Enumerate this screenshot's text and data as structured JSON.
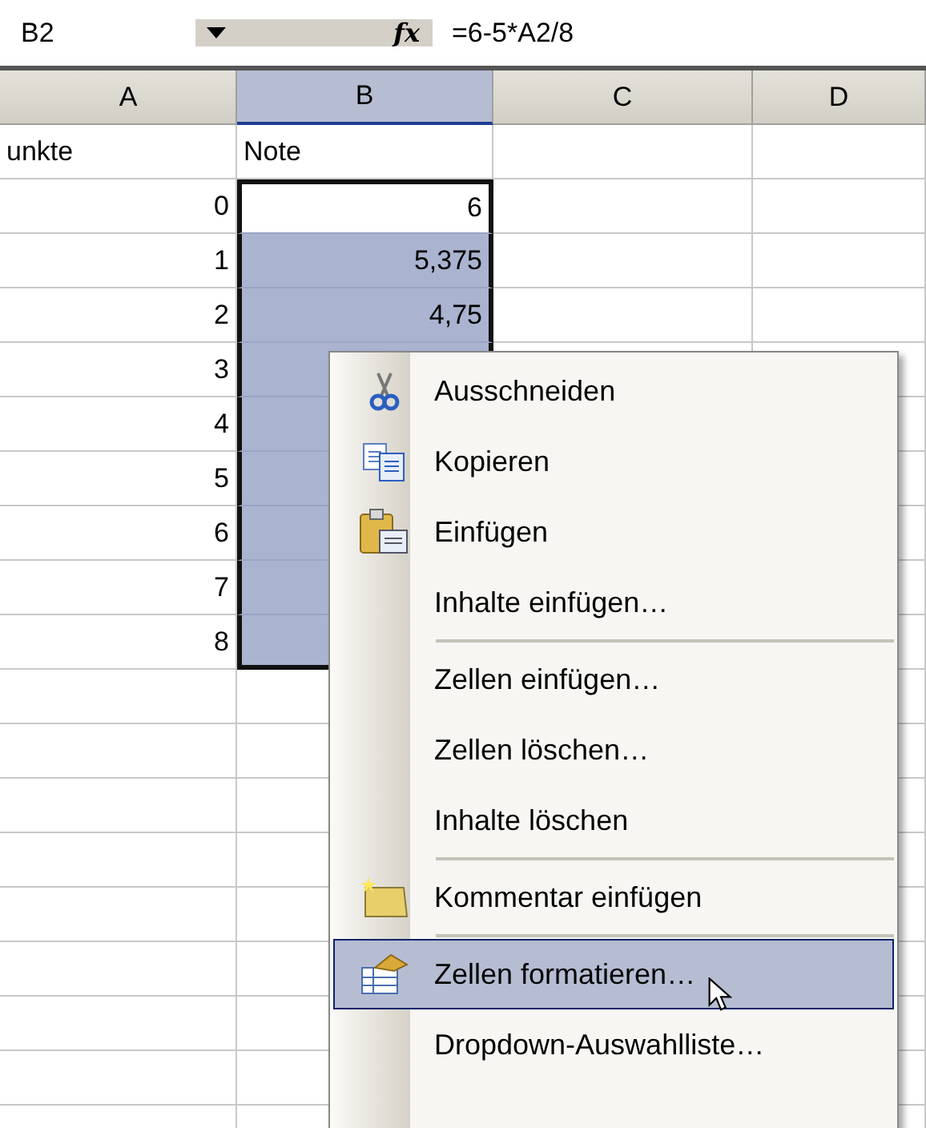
{
  "formula_bar": {
    "name_box": "B2",
    "function_label": "fx",
    "formula": "=6-5*A2/8"
  },
  "columns": [
    {
      "label": "A",
      "selected": false
    },
    {
      "label": "B",
      "selected": true
    },
    {
      "label": "C",
      "selected": false
    },
    {
      "label": "D",
      "selected": false
    }
  ],
  "rows": [
    {
      "cells": [
        {
          "value": "unkte",
          "kind": "text"
        },
        {
          "value": "Note",
          "kind": "text",
          "selected": false
        },
        {},
        {}
      ]
    },
    {
      "cells": [
        {
          "value": "0",
          "kind": "number"
        },
        {
          "value": "6",
          "kind": "number",
          "selected": true,
          "active": true
        },
        {},
        {}
      ]
    },
    {
      "cells": [
        {
          "value": "1",
          "kind": "number"
        },
        {
          "value": "5,375",
          "kind": "number",
          "selected": true,
          "active": false
        },
        {},
        {}
      ]
    },
    {
      "cells": [
        {
          "value": "2",
          "kind": "number"
        },
        {
          "value": "4,75",
          "kind": "number",
          "selected": true,
          "active": false
        },
        {},
        {}
      ]
    },
    {
      "cells": [
        {
          "value": "3",
          "kind": "number"
        },
        {
          "selected": true,
          "active": false
        },
        {},
        {}
      ]
    },
    {
      "cells": [
        {
          "value": "4",
          "kind": "number"
        },
        {
          "selected": true,
          "active": false
        },
        {},
        {}
      ]
    },
    {
      "cells": [
        {
          "value": "5",
          "kind": "number"
        },
        {
          "selected": true,
          "active": false
        },
        {},
        {}
      ]
    },
    {
      "cells": [
        {
          "value": "6",
          "kind": "number"
        },
        {
          "selected": true,
          "active": false
        },
        {},
        {}
      ]
    },
    {
      "cells": [
        {
          "value": "7",
          "kind": "number"
        },
        {
          "selected": true,
          "active": false
        },
        {},
        {}
      ]
    },
    {
      "cells": [
        {
          "value": "8",
          "kind": "number"
        },
        {
          "selected": true,
          "active": false
        },
        {},
        {}
      ]
    }
  ],
  "context_menu": {
    "items": [
      {
        "kind": "cut",
        "label": "Ausschneiden",
        "selected": false
      },
      {
        "kind": "copy",
        "label": "Kopieren",
        "selected": false
      },
      {
        "kind": "paste",
        "label": "Einfügen",
        "selected": false
      },
      {
        "kind": "plain",
        "label": "Inhalte einfügen…",
        "selected": false
      },
      {
        "kind": "separator"
      },
      {
        "kind": "plain",
        "label": "Zellen einfügen…",
        "selected": false
      },
      {
        "kind": "plain",
        "label": "Zellen löschen…",
        "selected": false
      },
      {
        "kind": "plain",
        "label": "Inhalte löschen",
        "selected": false
      },
      {
        "kind": "separator"
      },
      {
        "kind": "comment",
        "label": "Kommentar einfügen",
        "selected": false
      },
      {
        "kind": "separator"
      },
      {
        "kind": "format",
        "label": "Zellen formatieren…",
        "selected": true
      },
      {
        "kind": "plain",
        "label": "Dropdown-Auswahlliste…",
        "selected": false
      }
    ]
  }
}
